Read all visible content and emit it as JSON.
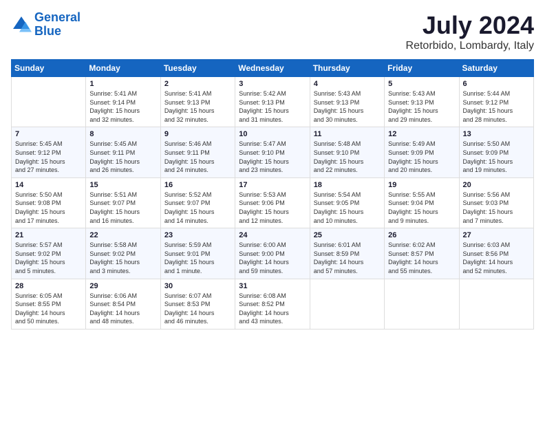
{
  "logo": {
    "line1": "General",
    "line2": "Blue"
  },
  "title": {
    "month_year": "July 2024",
    "location": "Retorbido, Lombardy, Italy"
  },
  "days_header": [
    "Sunday",
    "Monday",
    "Tuesday",
    "Wednesday",
    "Thursday",
    "Friday",
    "Saturday"
  ],
  "weeks": [
    [
      {
        "day": "",
        "content": ""
      },
      {
        "day": "1",
        "content": "Sunrise: 5:41 AM\nSunset: 9:14 PM\nDaylight: 15 hours\nand 32 minutes."
      },
      {
        "day": "2",
        "content": "Sunrise: 5:41 AM\nSunset: 9:13 PM\nDaylight: 15 hours\nand 32 minutes."
      },
      {
        "day": "3",
        "content": "Sunrise: 5:42 AM\nSunset: 9:13 PM\nDaylight: 15 hours\nand 31 minutes."
      },
      {
        "day": "4",
        "content": "Sunrise: 5:43 AM\nSunset: 9:13 PM\nDaylight: 15 hours\nand 30 minutes."
      },
      {
        "day": "5",
        "content": "Sunrise: 5:43 AM\nSunset: 9:13 PM\nDaylight: 15 hours\nand 29 minutes."
      },
      {
        "day": "6",
        "content": "Sunrise: 5:44 AM\nSunset: 9:12 PM\nDaylight: 15 hours\nand 28 minutes."
      }
    ],
    [
      {
        "day": "7",
        "content": "Sunrise: 5:45 AM\nSunset: 9:12 PM\nDaylight: 15 hours\nand 27 minutes."
      },
      {
        "day": "8",
        "content": "Sunrise: 5:45 AM\nSunset: 9:11 PM\nDaylight: 15 hours\nand 26 minutes."
      },
      {
        "day": "9",
        "content": "Sunrise: 5:46 AM\nSunset: 9:11 PM\nDaylight: 15 hours\nand 24 minutes."
      },
      {
        "day": "10",
        "content": "Sunrise: 5:47 AM\nSunset: 9:10 PM\nDaylight: 15 hours\nand 23 minutes."
      },
      {
        "day": "11",
        "content": "Sunrise: 5:48 AM\nSunset: 9:10 PM\nDaylight: 15 hours\nand 22 minutes."
      },
      {
        "day": "12",
        "content": "Sunrise: 5:49 AM\nSunset: 9:09 PM\nDaylight: 15 hours\nand 20 minutes."
      },
      {
        "day": "13",
        "content": "Sunrise: 5:50 AM\nSunset: 9:09 PM\nDaylight: 15 hours\nand 19 minutes."
      }
    ],
    [
      {
        "day": "14",
        "content": "Sunrise: 5:50 AM\nSunset: 9:08 PM\nDaylight: 15 hours\nand 17 minutes."
      },
      {
        "day": "15",
        "content": "Sunrise: 5:51 AM\nSunset: 9:07 PM\nDaylight: 15 hours\nand 16 minutes."
      },
      {
        "day": "16",
        "content": "Sunrise: 5:52 AM\nSunset: 9:07 PM\nDaylight: 15 hours\nand 14 minutes."
      },
      {
        "day": "17",
        "content": "Sunrise: 5:53 AM\nSunset: 9:06 PM\nDaylight: 15 hours\nand 12 minutes."
      },
      {
        "day": "18",
        "content": "Sunrise: 5:54 AM\nSunset: 9:05 PM\nDaylight: 15 hours\nand 10 minutes."
      },
      {
        "day": "19",
        "content": "Sunrise: 5:55 AM\nSunset: 9:04 PM\nDaylight: 15 hours\nand 9 minutes."
      },
      {
        "day": "20",
        "content": "Sunrise: 5:56 AM\nSunset: 9:03 PM\nDaylight: 15 hours\nand 7 minutes."
      }
    ],
    [
      {
        "day": "21",
        "content": "Sunrise: 5:57 AM\nSunset: 9:02 PM\nDaylight: 15 hours\nand 5 minutes."
      },
      {
        "day": "22",
        "content": "Sunrise: 5:58 AM\nSunset: 9:02 PM\nDaylight: 15 hours\nand 3 minutes."
      },
      {
        "day": "23",
        "content": "Sunrise: 5:59 AM\nSunset: 9:01 PM\nDaylight: 15 hours\nand 1 minute."
      },
      {
        "day": "24",
        "content": "Sunrise: 6:00 AM\nSunset: 9:00 PM\nDaylight: 14 hours\nand 59 minutes."
      },
      {
        "day": "25",
        "content": "Sunrise: 6:01 AM\nSunset: 8:59 PM\nDaylight: 14 hours\nand 57 minutes."
      },
      {
        "day": "26",
        "content": "Sunrise: 6:02 AM\nSunset: 8:57 PM\nDaylight: 14 hours\nand 55 minutes."
      },
      {
        "day": "27",
        "content": "Sunrise: 6:03 AM\nSunset: 8:56 PM\nDaylight: 14 hours\nand 52 minutes."
      }
    ],
    [
      {
        "day": "28",
        "content": "Sunrise: 6:05 AM\nSunset: 8:55 PM\nDaylight: 14 hours\nand 50 minutes."
      },
      {
        "day": "29",
        "content": "Sunrise: 6:06 AM\nSunset: 8:54 PM\nDaylight: 14 hours\nand 48 minutes."
      },
      {
        "day": "30",
        "content": "Sunrise: 6:07 AM\nSunset: 8:53 PM\nDaylight: 14 hours\nand 46 minutes."
      },
      {
        "day": "31",
        "content": "Sunrise: 6:08 AM\nSunset: 8:52 PM\nDaylight: 14 hours\nand 43 minutes."
      },
      {
        "day": "",
        "content": ""
      },
      {
        "day": "",
        "content": ""
      },
      {
        "day": "",
        "content": ""
      }
    ]
  ]
}
